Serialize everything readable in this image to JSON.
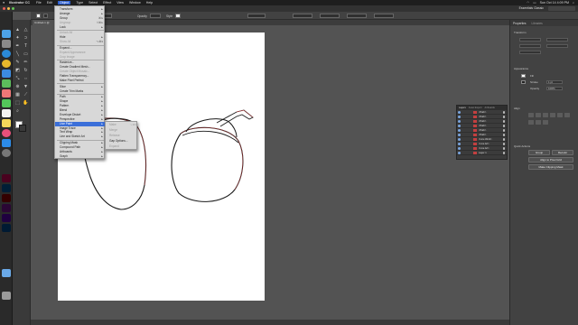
{
  "menubar": {
    "app": "Illustrator CC",
    "items": [
      "File",
      "Edit",
      "Object",
      "Type",
      "Select",
      "Effect",
      "View",
      "Window",
      "Help"
    ],
    "active_item": "Object",
    "clock": "Sun Oct 14  4:09 PM"
  },
  "appbar": {
    "workspace": "Essentials Classic"
  },
  "control": {
    "opacity_label": "Opacity",
    "opacity_value": "100%",
    "style_label": "Style"
  },
  "document_tab": "Untitled-1 @ 66.67%",
  "object_menu": {
    "items": [
      {
        "label": "Transform",
        "submenu": true
      },
      {
        "label": "Arrange",
        "submenu": true
      },
      {
        "label": "Group",
        "shortcut": "⌘G"
      },
      {
        "label": "Ungroup",
        "shortcut": "⇧⌘G",
        "disabled": true
      },
      {
        "label": "Lock",
        "submenu": true
      },
      {
        "label": "Unlock All",
        "disabled": true
      },
      {
        "label": "Hide",
        "submenu": true
      },
      {
        "label": "Show All",
        "shortcut": "⌥⌘3",
        "disabled": true
      },
      {
        "label": "Expand..."
      },
      {
        "label": "Expand Appearance",
        "disabled": true
      },
      {
        "label": "Crop Image",
        "disabled": true
      },
      {
        "label": "Rasterize..."
      },
      {
        "label": "Create Gradient Mesh..."
      },
      {
        "label": "Create Object Mosaic...",
        "disabled": true
      },
      {
        "label": "Flatten Transparency..."
      },
      {
        "label": "Make Pixel Perfect"
      },
      {
        "label": "Slice",
        "submenu": true
      },
      {
        "label": "Create Trim Marks"
      },
      {
        "label": "Path",
        "submenu": true
      },
      {
        "label": "Shape",
        "submenu": true
      },
      {
        "label": "Pattern",
        "submenu": true
      },
      {
        "label": "Blend",
        "submenu": true
      },
      {
        "label": "Envelope Distort",
        "submenu": true
      },
      {
        "label": "Perspective",
        "submenu": true
      },
      {
        "label": "Live Paint",
        "submenu": true,
        "highlighted": true
      },
      {
        "label": "Image Trace",
        "submenu": true
      },
      {
        "label": "Text Wrap",
        "submenu": true
      },
      {
        "label": "Line and Sketch Art",
        "submenu": true
      },
      {
        "label": "Clipping Mask",
        "submenu": true
      },
      {
        "label": "Compound Path",
        "submenu": true
      },
      {
        "label": "Artboards",
        "submenu": true
      },
      {
        "label": "Graph",
        "submenu": true
      }
    ]
  },
  "live_paint_submenu": {
    "items": [
      {
        "label": "Make",
        "shortcut": "⌥⌘X",
        "disabled": true
      },
      {
        "label": "Merge",
        "disabled": true
      },
      {
        "label": "Release",
        "disabled": true
      },
      {
        "label": "Gap Options..."
      },
      {
        "label": "Expand",
        "disabled": true
      }
    ]
  },
  "layers_panel": {
    "tabs": [
      "Layers",
      "Asset Export",
      "Artboards"
    ],
    "rows": [
      "<Path>",
      "<Path>",
      "<Path>",
      "<Path>",
      "<Path>",
      "<Path>",
      "<Line Work>",
      "<Live Art>",
      "<Live Art>",
      "Layer 1"
    ]
  },
  "properties_panel": {
    "tabs": [
      "Properties",
      "Libraries"
    ],
    "section_transform": "Transform",
    "section_appearance": "Appearance",
    "fill_label": "Fill",
    "stroke_label": "Stroke",
    "stroke_value": "1 pt",
    "opacity_label": "Opacity",
    "opacity_value": "100%",
    "section_align": "Align",
    "section_quick_actions": "Quick Actions",
    "btn_group": "Group",
    "btn_recolor": "Recolor",
    "btn_align": "Align to Pixel Grid",
    "btn_clipping": "Make Clipping Mask"
  },
  "colors": {
    "menu_highlight": "#3b6fd9",
    "path_stroke": "#1a1a1a",
    "path_selection": "#d23c3c"
  }
}
